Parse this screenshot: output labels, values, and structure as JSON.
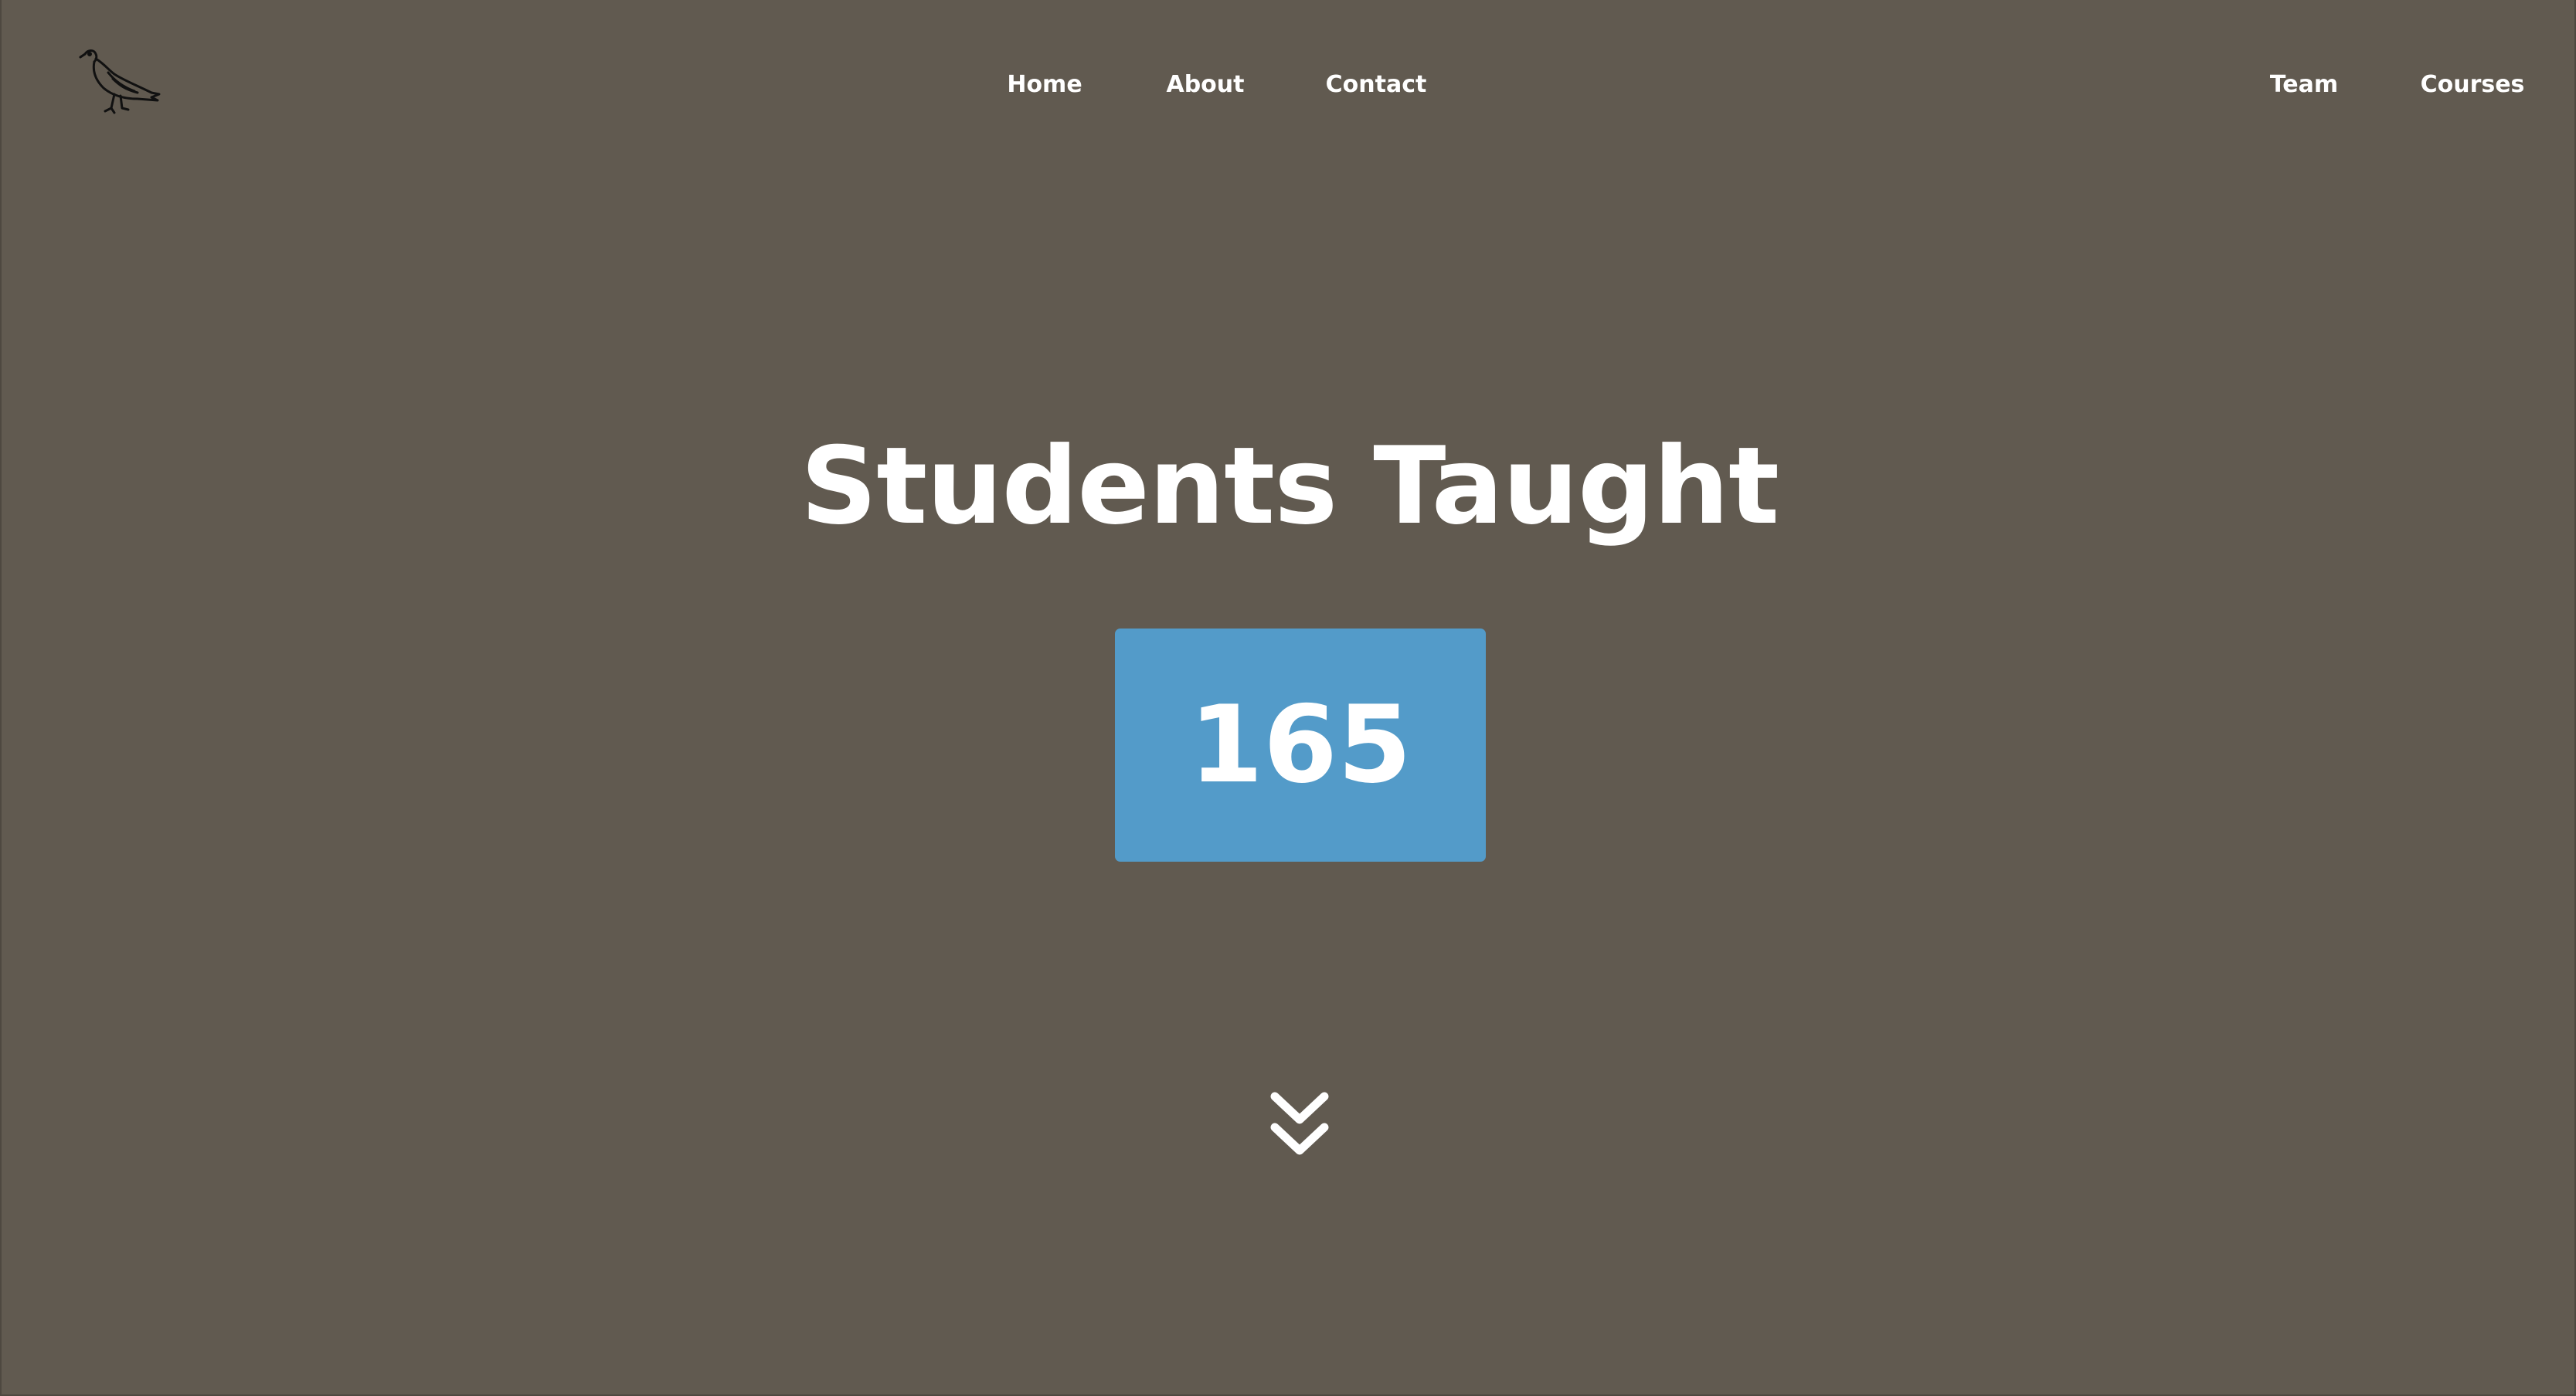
{
  "logo": {
    "icon": "pigeon-icon"
  },
  "nav": {
    "home": "Home",
    "about": "About",
    "contact": "Contact",
    "team": "Team",
    "courses": "Courses"
  },
  "hero": {
    "title": "Students Taught",
    "counter": "165"
  },
  "scroll": {
    "icon": "double-chevron-down-icon"
  },
  "colors": {
    "background": "#615a50",
    "counter_box": "#539bc9",
    "text": "#ffffff",
    "logo_stroke": "#111111"
  }
}
